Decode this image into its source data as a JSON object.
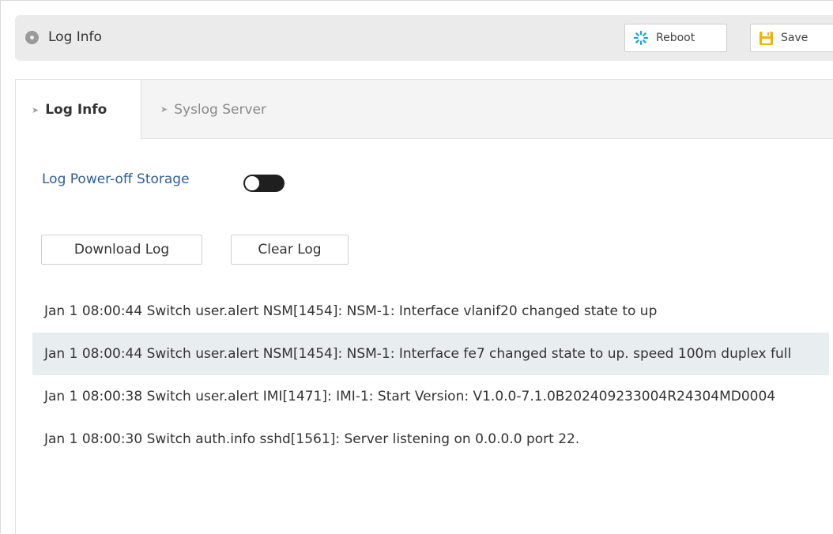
{
  "header": {
    "title": "Log Info",
    "reboot_label": "Reboot",
    "save_label": "Save"
  },
  "tabs": [
    {
      "label": "Log Info",
      "active": true
    },
    {
      "label": "Syslog Server",
      "active": false
    }
  ],
  "storage": {
    "label": "Log Power-off Storage",
    "enabled": false
  },
  "actions": {
    "download_label": "Download Log",
    "clear_label": "Clear Log"
  },
  "logs": [
    "Jan 1 08:00:44 Switch user.alert NSM[1454]: NSM-1: Interface vlanif20 changed state to up",
    "Jan 1 08:00:44 Switch user.alert NSM[1454]: NSM-1: Interface fe7 changed state to up. speed 100m duplex full",
    "Jan 1 08:00:38 Switch user.alert IMI[1471]: IMI-1: Start Version: V1.0.0-7.1.0B202409233004R24304MD0004",
    "Jan 1 08:00:30 Switch auth.info sshd[1561]: Server listening on 0.0.0.0 port 22."
  ],
  "colors": {
    "accent_label": "#2e5f94",
    "reboot_icon": "#1aa3d9",
    "save_icon": "#f2b300",
    "alt_row": "#e8edf0"
  },
  "icons": {
    "header": "circle-dot-icon",
    "reboot": "spinner-icon",
    "save": "floppy-icon",
    "tab_arrow": "chevron-right-icon"
  }
}
